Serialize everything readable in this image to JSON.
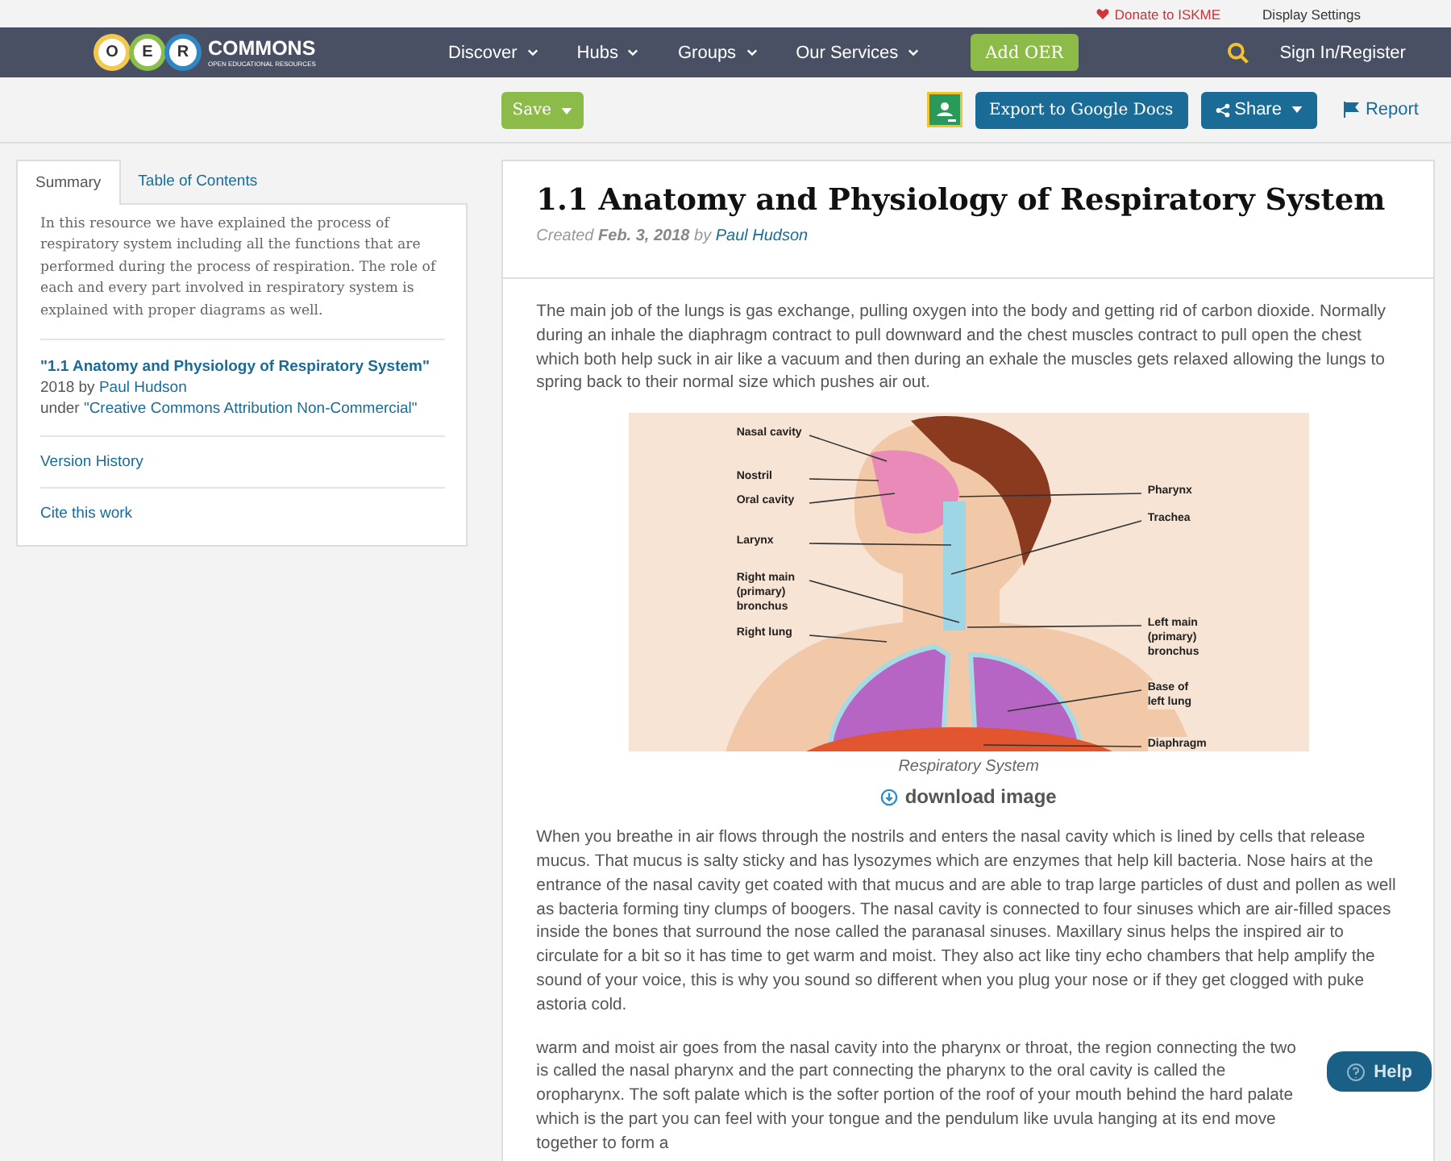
{
  "top_bar": {
    "donate": "Donate to ISKME",
    "display_settings": "Display Settings"
  },
  "logo": {
    "letters": [
      {
        "letter": "O",
        "color": "#f2c94c"
      },
      {
        "letter": "E",
        "color": "#8cbf4a"
      },
      {
        "letter": "R",
        "color": "#2f86c5"
      }
    ],
    "name": "COMMONS",
    "tagline": "OPEN EDUCATIONAL RESOURCES"
  },
  "nav": [
    {
      "label": "Discover"
    },
    {
      "label": "Hubs"
    },
    {
      "label": "Groups"
    },
    {
      "label": "Our Services"
    }
  ],
  "add_button": "Add OER",
  "sign_in": "Sign In/Register",
  "toolbar": {
    "save": "Save",
    "export": "Export to Google Docs",
    "share": "Share",
    "report": "Report"
  },
  "sidebar": {
    "tabs": [
      {
        "label": "Summary",
        "selected": true
      },
      {
        "label": "Table of Contents",
        "selected": false
      }
    ],
    "summary": "In this resource we have explained the process of respiratory system including all the functions that are performed during the process of respiration. The role of each and every part involved in respiratory system is explained with proper diagrams as well.",
    "resource_title": "\"1.1 Anatomy and Physiology of Respiratory System\"",
    "year": "2018 by",
    "author": "Paul Hudson",
    "license_prefix": "under",
    "license": "\"Creative Commons Attribution Non-Commercial\"",
    "links": [
      "Version History",
      "Cite this work"
    ]
  },
  "article": {
    "title": "1.1 Anatomy and Physiology of Respiratory System",
    "created_label": "Created",
    "date": "Feb. 3, 2018",
    "by": "by",
    "author": "Paul Hudson",
    "intro": "The main job of the lungs is gas exchange, pulling oxygen into the body and getting rid of carbon dioxide. Normally during an inhale the diaphragm contract to pull downward and the chest muscles contract to pull open the chest which both help suck in air like a vacuum and then during an exhale the muscles gets relaxed allowing the lungs to spring back to their normal size which pushes air out.",
    "figure": {
      "labels": [
        {
          "text": "Nasal cavity"
        },
        {
          "text": "Nostril"
        },
        {
          "text": "Oral cavity"
        },
        {
          "text": "Larynx"
        },
        {
          "text": "Right main\n(primary)\nbronchus"
        },
        {
          "text": "Right lung"
        },
        {
          "text": "Pharynx"
        },
        {
          "text": "Trachea"
        },
        {
          "text": "Left main\n(primary)\nbronchus"
        },
        {
          "text": "Base of\nleft lung"
        },
        {
          "text": "Diaphragm"
        }
      ],
      "caption": "Respiratory System",
      "download": "download image"
    },
    "paragraphs": [
      "When you breathe in air flows through the nostrils and enters the nasal cavity which is lined by cells that release mucus. That mucus is salty sticky and has lysozymes which are enzymes that help kill bacteria. Nose hairs at the entrance of the nasal cavity get coated with that mucus and are able to trap large particles of dust and pollen as well as bacteria forming tiny clumps of boogers. The nasal cavity is connected to four sinuses which are air-filled spaces inside the bones that surround the nose called the paranasal sinuses. Maxillary sinus helps the inspired air to circulate for a bit so it has time to get warm and moist. They also act like tiny echo chambers that help amplify the sound of your voice, this is why you sound so different when you plug your nose or if they get clogged with puke astoria cold.",
      "warm and moist air goes from the nasal cavity into the pharynx or throat, the region connecting the two is called the nasal pharynx and the part connecting the pharynx to the oral cavity is called the oropharynx. The soft palate which is the softer portion of the roof of your mouth behind the hard palate which is the part you can feel with your tongue and the pendulum like uvula hanging at its end move together to form a"
    ]
  },
  "help": "Help"
}
